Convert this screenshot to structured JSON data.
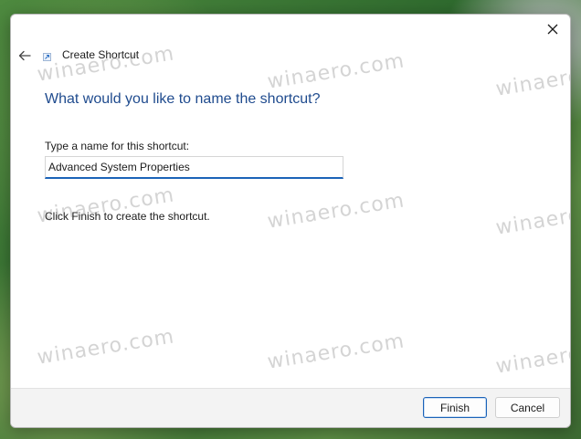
{
  "window": {
    "title": "Create Shortcut",
    "close_icon": "close-icon",
    "back_icon": "back-arrow-icon",
    "app_icon": "shortcut-icon"
  },
  "page": {
    "heading": "What would you like to name the shortcut?",
    "name_label": "Type a name for this shortcut:",
    "name_value": "Advanced System Properties",
    "info": "Click Finish to create the shortcut."
  },
  "footer": {
    "finish_label": "Finish",
    "cancel_label": "Cancel"
  },
  "watermark": "winaero.com",
  "colors": {
    "heading": "#1f4b8e",
    "accent": "#1b63b8"
  }
}
